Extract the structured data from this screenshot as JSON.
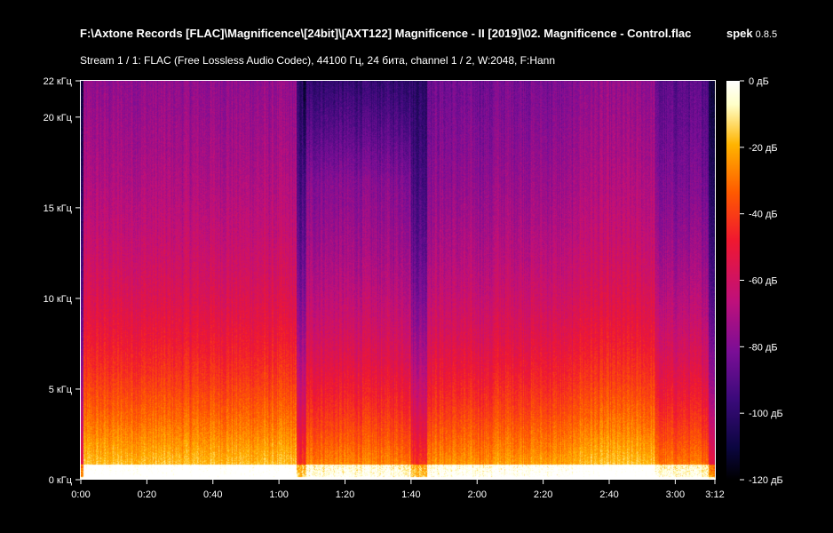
{
  "header": {
    "file_path": "F:\\Axtone Records [FLAC]\\Magnificence\\[24bit]\\[AXT122] Magnificence - II [2019]\\02. Magnificence - Control.flac",
    "app_name": "spek",
    "app_version": "0.8.5",
    "stream_info": "Stream 1 / 1: FLAC (Free Lossless Audio Codec), 44100 Гц, 24 бита, channel 1 / 2, W:2048, F:Hann"
  },
  "colors": {
    "background": "#000000",
    "palette": [
      "#000000",
      "#0b0640",
      "#3a0a7a",
      "#7a0e96",
      "#c0107a",
      "#f01830",
      "#ff5a00",
      "#ffb400",
      "#ffffc8",
      "#ffffff"
    ]
  },
  "chart_data": {
    "type": "heatmap",
    "title": "",
    "xlabel": "",
    "ylabel": "",
    "x_ticks": [
      "0:00",
      "0:20",
      "0:40",
      "1:00",
      "1:20",
      "1:40",
      "2:00",
      "2:20",
      "2:40",
      "3:00",
      "3:12"
    ],
    "x_tick_seconds": [
      0,
      20,
      40,
      60,
      80,
      100,
      120,
      140,
      160,
      180,
      192
    ],
    "xlim_seconds": [
      0,
      192
    ],
    "y_ticks": [
      "0 кГц",
      "5 кГц",
      "10 кГц",
      "15 кГц",
      "20 кГц",
      "22 кГц"
    ],
    "y_tick_khz": [
      0,
      5,
      10,
      15,
      20,
      22
    ],
    "ylim_khz": [
      0,
      22
    ],
    "colorbar_ticks": [
      "0 дБ",
      "-20 дБ",
      "-40 дБ",
      "-60 дБ",
      "-80 дБ",
      "-100 дБ",
      "-120 дБ"
    ],
    "colorbar_db": [
      0,
      -20,
      -40,
      -60,
      -80,
      -100,
      -120
    ],
    "colorbar_range_db": [
      -120,
      0
    ]
  }
}
